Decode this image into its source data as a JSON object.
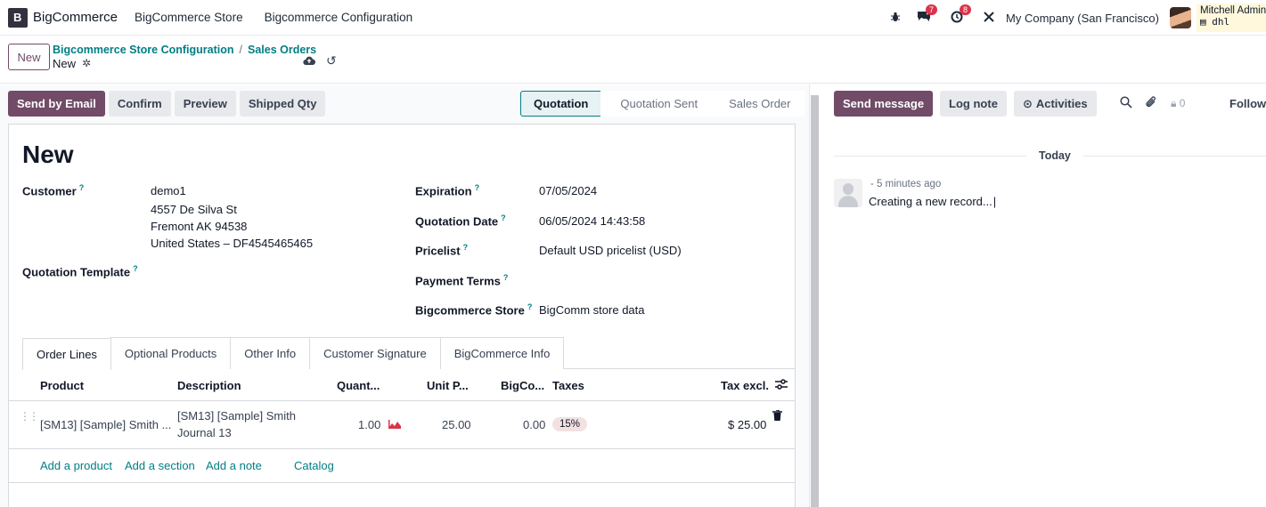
{
  "topnav": {
    "app_name": "BigCommerce",
    "menus": [
      "BigCommerce Store",
      "Bigcommerce Configuration"
    ],
    "messages_badge": "7",
    "activities_badge": "8",
    "company": "My Company (San Francisco)",
    "user_name": "Mitchell Admin",
    "user_db": "dhl"
  },
  "control": {
    "new_label": "New",
    "breadcrumb_1": "Bigcommerce Store Configuration",
    "breadcrumb_sep": "/",
    "breadcrumb_2": "Sales Orders",
    "record_name": "New"
  },
  "actions": {
    "send_email": "Send by Email",
    "confirm": "Confirm",
    "preview": "Preview",
    "shipped_qty": "Shipped Qty"
  },
  "status": {
    "stages": [
      "Quotation",
      "Quotation Sent",
      "Sales Order"
    ],
    "active": "Quotation"
  },
  "form": {
    "title": "New",
    "customer_label": "Customer",
    "customer_name": "demo1",
    "customer_addr1": "4557 De Silva St",
    "customer_addr2": "Fremont AK 94538",
    "customer_addr3": "United States – DF4545465465",
    "template_label": "Quotation Template",
    "expiration_label": "Expiration",
    "expiration_value": "07/05/2024",
    "qdate_label": "Quotation Date",
    "qdate_value": "06/05/2024 14:43:58",
    "pricelist_label": "Pricelist",
    "pricelist_value": "Default USD pricelist (USD)",
    "payment_label": "Payment Terms",
    "store_label": "Bigcommerce Store",
    "store_value": "BigComm store data",
    "help_mark": "?"
  },
  "tabs": [
    "Order Lines",
    "Optional Products",
    "Other Info",
    "Customer Signature",
    "BigCommerce Info"
  ],
  "table": {
    "headers": {
      "product": "Product",
      "description": "Description",
      "quantity": "Quant...",
      "unit_price": "Unit P...",
      "bigco": "BigCo...",
      "taxes": "Taxes",
      "tax_excl": "Tax excl."
    },
    "row": {
      "product": "[SM13] [Sample] Smith ...",
      "desc_line1": "[SM13] [Sample] Smith",
      "desc_line2": "Journal 13",
      "quantity": "1.00",
      "unit_price": "25.00",
      "bigco": "0.00",
      "tax": "15%",
      "subtotal": "$ 25.00"
    },
    "links": {
      "add_product": "Add a product",
      "add_section": "Add a section",
      "add_note": "Add a note",
      "catalog": "Catalog"
    }
  },
  "chatter": {
    "send_message": "Send message",
    "log_note": "Log note",
    "activities": "Activities",
    "followers_count": "0",
    "follow": "Follow",
    "today": "Today",
    "msg_time": "- 5 minutes ago",
    "msg_body": "Creating a new record..."
  },
  "colors": {
    "primary": "#714b67",
    "link": "#017e84",
    "badge": "#d9344a"
  }
}
